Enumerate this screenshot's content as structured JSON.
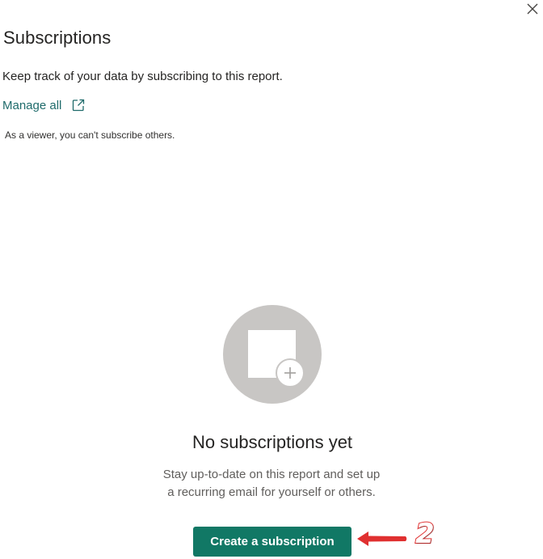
{
  "panel": {
    "title": "Subscriptions",
    "description": "Keep track of your data by subscribing to this report.",
    "manage_link_label": "Manage all",
    "viewer_note": "As a viewer, you can't subscribe others."
  },
  "empty_state": {
    "title": "No subscriptions yet",
    "description_line1": "Stay up-to-date on this report and set up",
    "description_line2": "a recurring email for yourself or others."
  },
  "actions": {
    "create_label": "Create a subscription"
  },
  "annotation": {
    "step_number": "2"
  },
  "icons": {
    "close": "close-icon",
    "external_link": "external-link-icon",
    "empty_illustration": "subscription-add-illustration",
    "annotation_arrow": "arrow-left-icon"
  },
  "colors": {
    "accent": "#117865",
    "link": "#1f6b6b",
    "text": "#252423",
    "muted_text": "#605e5c",
    "illustration_circle": "#c8c6c4",
    "annotation_red": "#e03030"
  }
}
